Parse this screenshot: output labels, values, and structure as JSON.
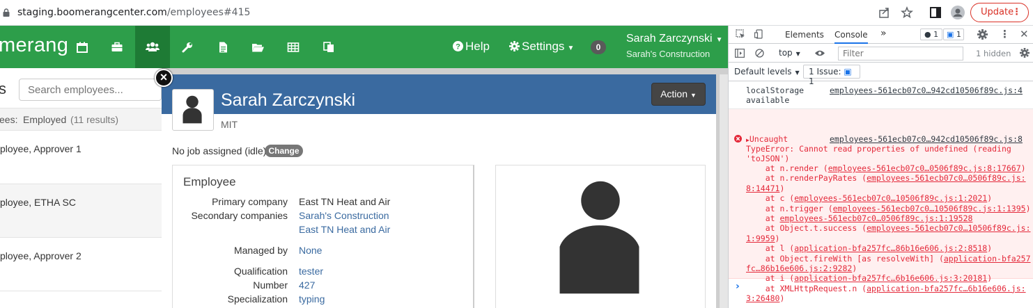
{
  "browser": {
    "url_host": "staging.boomerangcenter.com",
    "url_path": "/employees#415",
    "update_label": "Update"
  },
  "navbar": {
    "logo": "merang",
    "help": "Help",
    "settings": "Settings",
    "badge_count": "0",
    "user_name": "Sarah Zarczynski",
    "user_company": "Sarah's Construction"
  },
  "employee_list": {
    "title": "s",
    "search_placeholder": "Search employees...",
    "filter_label": "ees:",
    "filter_value": "Employed",
    "filter_count": "(11 results)",
    "rows": [
      "ployee, Approver 1",
      "ployee, ETHA SC",
      "ployee, Approver 2"
    ]
  },
  "modal": {
    "close": "×",
    "name": "Sarah Zarczynski",
    "subtitle": "MIT",
    "action": "Action",
    "job_status": "No job assigned (idle)",
    "change": "Change",
    "panel_title": "Employee",
    "fields": {
      "primary_company_label": "Primary company",
      "primary_company": "East TN Heat and Air",
      "secondary_companies_label": "Secondary companies",
      "secondary_company_1": "Sarah's Construction",
      "secondary_company_2": "East TN Heat and Air",
      "managed_by_label": "Managed by",
      "managed_by": "None",
      "qualification_label": "Qualification",
      "qualification": "tester",
      "number_label": "Number",
      "number": "427",
      "specialization_label": "Specialization",
      "specialization": "typing"
    }
  },
  "devtools": {
    "tabs": {
      "elements": "Elements",
      "console": "Console",
      "more": "»",
      "errors_count": "1",
      "messages_count": "1"
    },
    "toolbar": {
      "context": "top",
      "filter_placeholder": "Filter",
      "hidden": "1 hidden"
    },
    "levels": {
      "default_levels": "Default levels",
      "issues": "1 Issue:",
      "issues_count": "1"
    },
    "info_message": {
      "line1": "localStorage",
      "line2": "available",
      "source": "employees-561ecb07c0…942cd10506f89c.js:4"
    },
    "error": {
      "head": "Uncaught",
      "source": "employees-561ecb07c0…942cd10506f89c.js:8",
      "message1": "TypeError: Cannot read properties of undefined (reading",
      "message2": "'toJSON')",
      "stack": [
        {
          "prefix": "    at n.render (",
          "link": "employees-561ecb07c0…0506f89c.js:8:17667",
          "suffix": ")"
        },
        {
          "prefix": "    at n.renderPayRates (",
          "link": "employees-561ecb07c0…0506f89c.js:",
          "suffix": ""
        },
        {
          "prefix": "",
          "link": "8:14471",
          "suffix": ")"
        },
        {
          "prefix": "    at c (",
          "link": "employees-561ecb07c0…10506f89c.js:1:2021",
          "suffix": ")"
        },
        {
          "prefix": "    at n.trigger (",
          "link": "employees-561ecb07c0…10506f89c.js:1:1395",
          "suffix": ")"
        },
        {
          "prefix": "    at ",
          "link": "employees-561ecb07c0…0506f89c.js:1:19528",
          "suffix": ""
        },
        {
          "prefix": "    at Object.t.success (",
          "link": "employees-561ecb07c0…10506f89c.js:",
          "suffix": ""
        },
        {
          "prefix": "",
          "link": "1:9959",
          "suffix": ")"
        },
        {
          "prefix": "    at l (",
          "link": "application-bfa257fc…86b16e606.js:2:8518",
          "suffix": ")"
        },
        {
          "prefix": "    at Object.fireWith [as resolveWith] (",
          "link": "application-bfa257",
          "suffix": ""
        },
        {
          "prefix": "",
          "link": "fc…86b16e606.js:2:9282",
          "suffix": ")"
        },
        {
          "prefix": "    at i (",
          "link": "application-bfa257fc…6b16e606.js:3:20181",
          "suffix": ")"
        },
        {
          "prefix": "    at XMLHttpRequest.n (",
          "link": "application-bfa257fc…6b16e606.js:",
          "suffix": ""
        },
        {
          "prefix": "",
          "link": "3:26480",
          "suffix": ")"
        }
      ]
    },
    "prompt": "›"
  },
  "colors": {
    "navbar_green": "#2d9e4a",
    "navbar_active": "#1e7b35",
    "modal_header_blue": "#3a6aa0",
    "link_blue": "#3a6aa0",
    "error_red": "#e4293a",
    "error_bg": "#fff0f0"
  }
}
